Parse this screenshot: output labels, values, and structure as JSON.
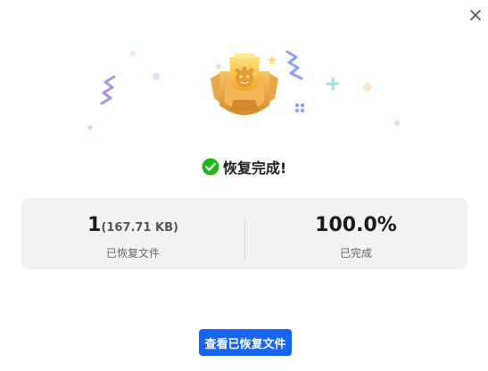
{
  "dialog": {
    "close_icon": "close-icon",
    "illustration": "trophy-badge-icon",
    "status_icon": "check-circle-icon",
    "status_text": "恢复完成!",
    "stats": {
      "recovered_count": "1",
      "recovered_size": "(167.71 KB)",
      "recovered_label": "已恢复文件",
      "progress_value": "100.0%",
      "progress_label": "已完成"
    },
    "view_button_label": "查看已恢复文件"
  },
  "colors": {
    "accent": "#1763f2",
    "success": "#1fb51f",
    "trophy_gold": "#f5b93a",
    "panel_bg": "#f2f2f3"
  }
}
